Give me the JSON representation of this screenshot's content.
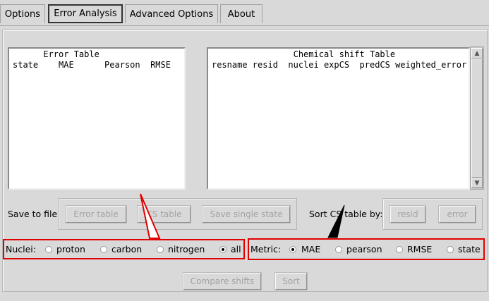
{
  "tabs": [
    {
      "label": "Options"
    },
    {
      "label": "Error Analysis"
    },
    {
      "label": "Advanced Options"
    },
    {
      "label": "About"
    }
  ],
  "error_table": {
    "text": "      Error Table\nstate    MAE      Pearson  RMSE"
  },
  "cs_table": {
    "text": "                Chemical shift Table\nresname resid  nuclei expCS  predCS weighted_error"
  },
  "save": {
    "label": "Save to file:",
    "error_table_button": "Error table",
    "cs_table_button": "CS table",
    "single_state_button": "Save single state"
  },
  "sort": {
    "label": "Sort CS table by:",
    "resid_button": "resid",
    "error_button": "error"
  },
  "nuclei": {
    "label": "Nuclei:",
    "options": [
      "proton",
      "carbon",
      "nitrogen",
      "all"
    ],
    "selected": "all"
  },
  "metric": {
    "label": "Metric:",
    "options": [
      "MAE",
      "pearson",
      "RMSE",
      "state"
    ],
    "selected": "MAE"
  },
  "bottom": {
    "compare_button": "Compare shifts",
    "sort_button": "Sort"
  },
  "colors": {
    "annotation_red": "#e00000",
    "annotation_black": "#000000"
  }
}
